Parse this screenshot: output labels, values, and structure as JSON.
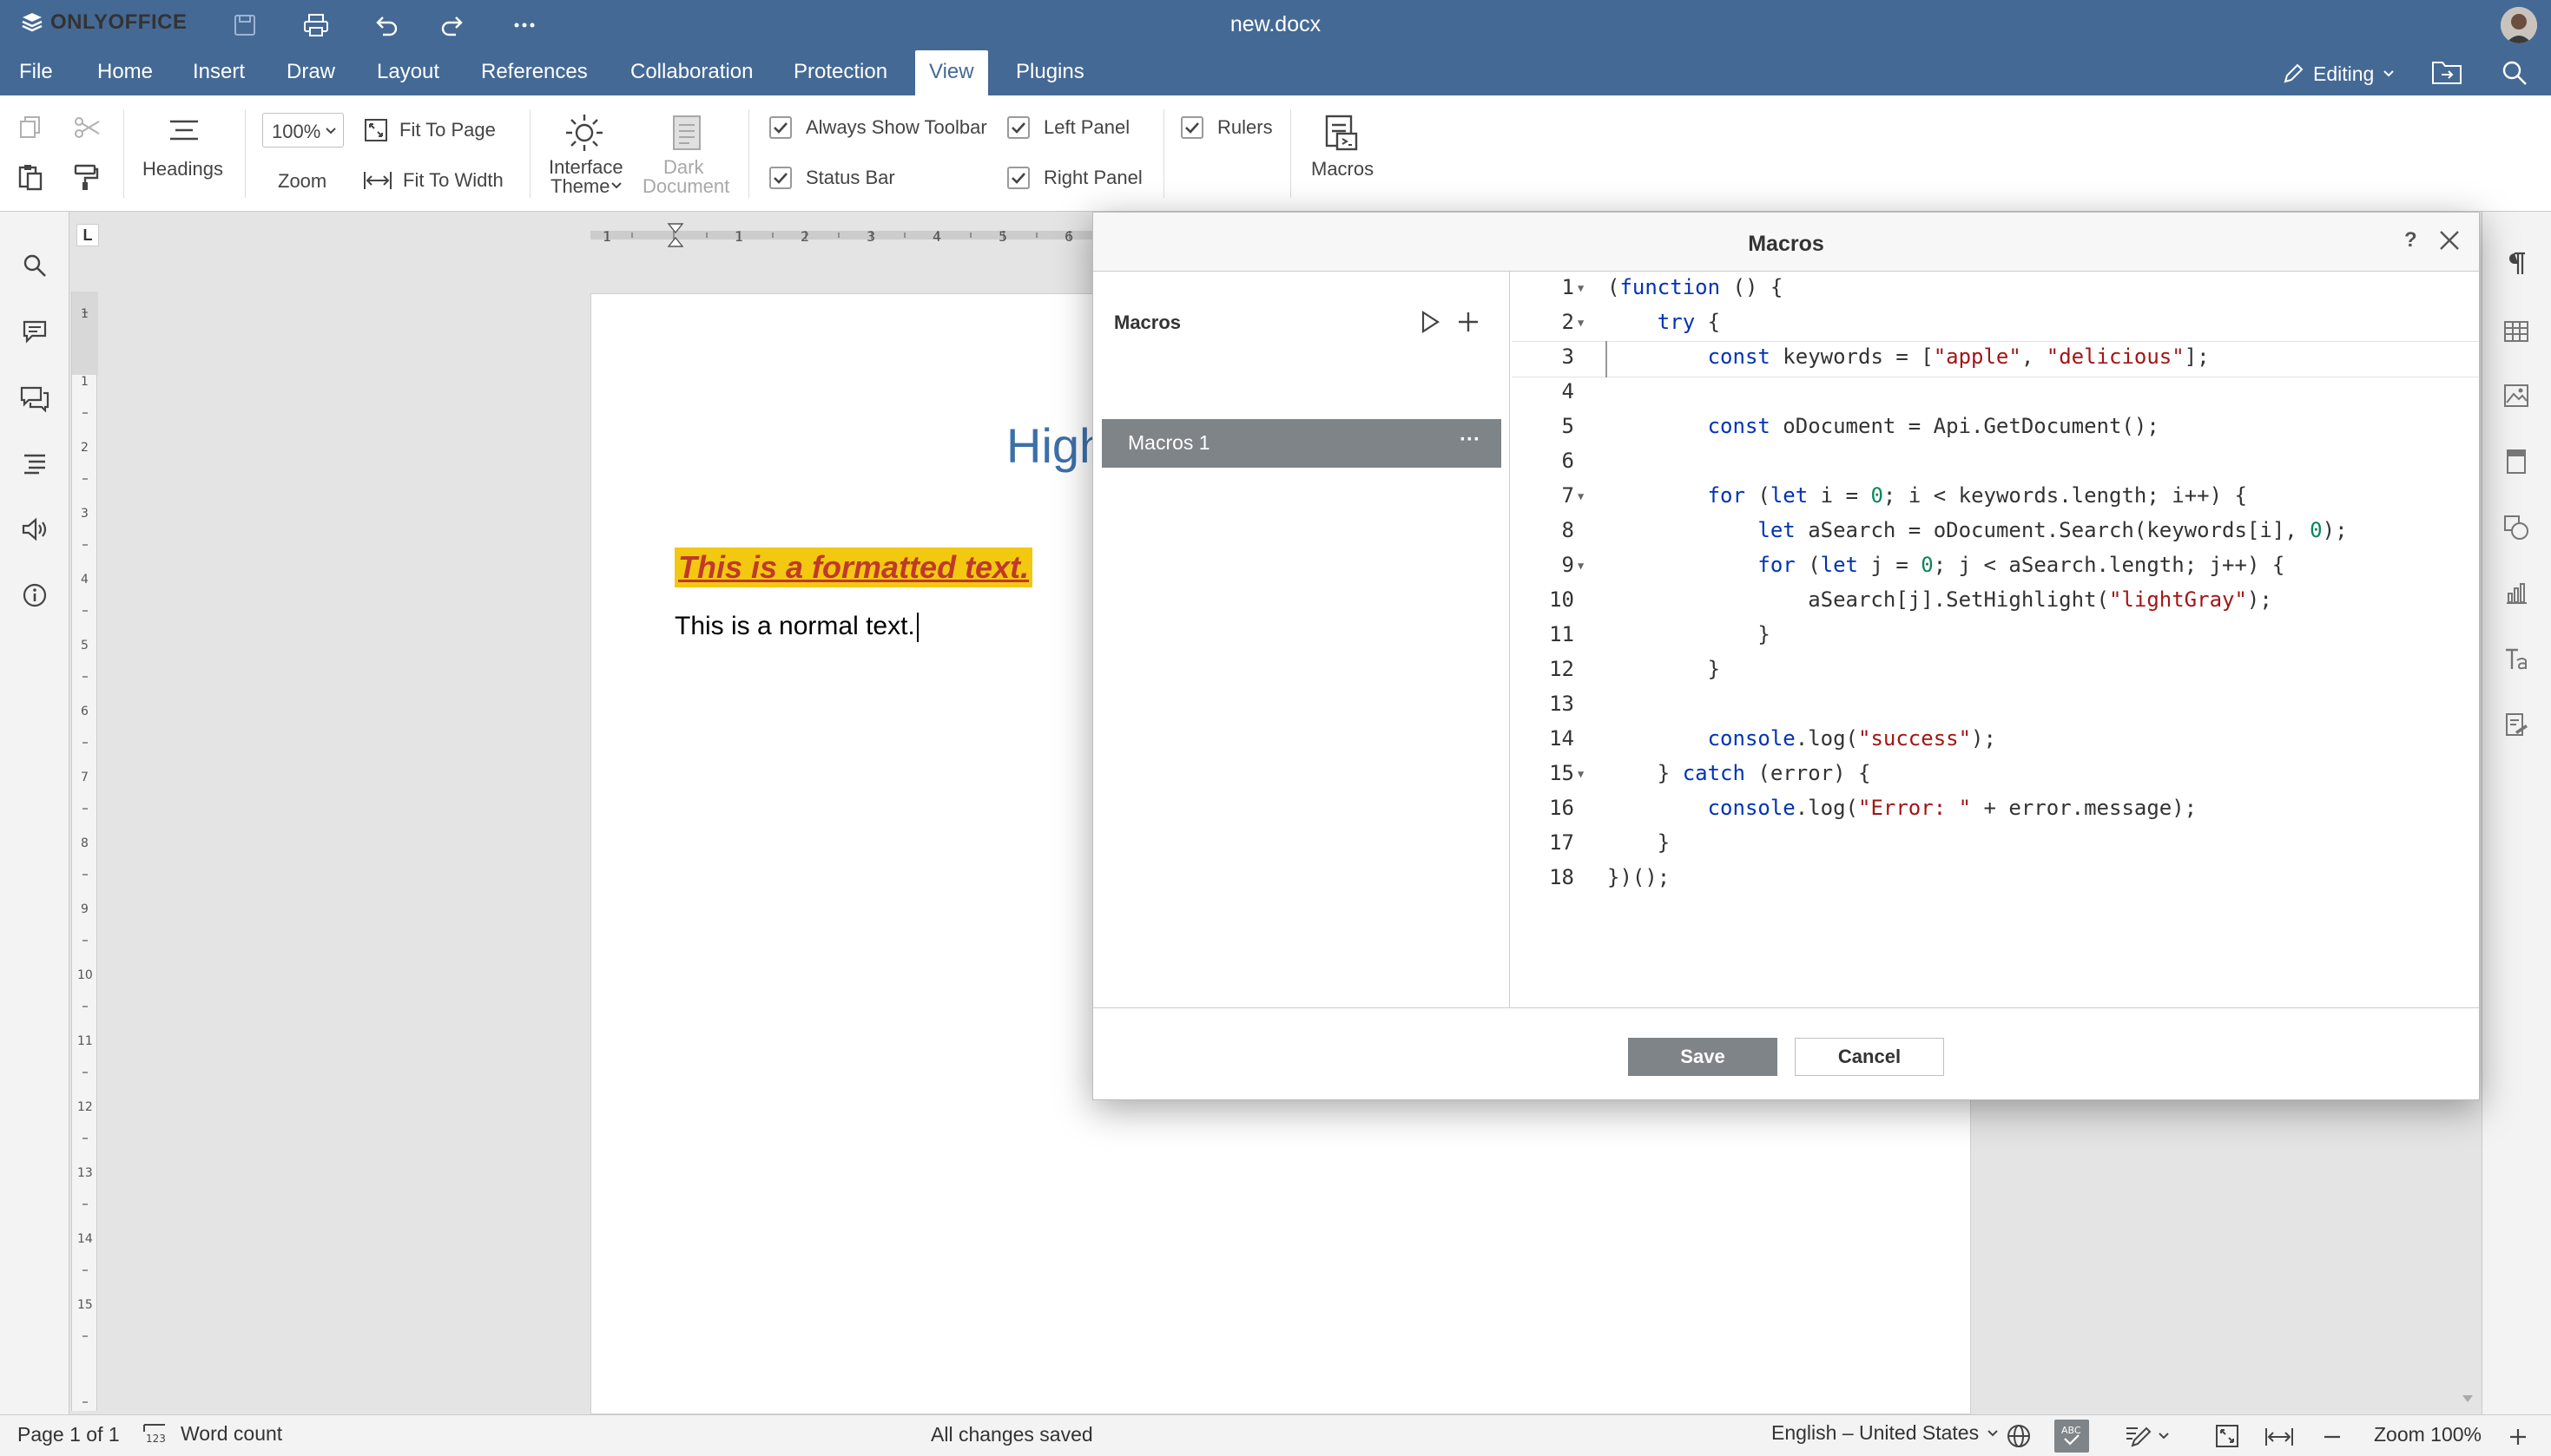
{
  "app": {
    "brand": "ONLYOFFICE",
    "doc_title": "new.docx"
  },
  "menu": [
    "File",
    "Home",
    "Insert",
    "Draw",
    "Layout",
    "References",
    "Collaboration",
    "Protection",
    "View",
    "Plugins"
  ],
  "menu_active": "View",
  "editing_label": "Editing",
  "toolbar": {
    "headings": "Headings",
    "zoom_value": "100%",
    "zoom": "Zoom",
    "fit_to_page": "Fit To Page",
    "fit_to_width": "Fit To Width",
    "interface_theme_1": "Interface",
    "interface_theme_2": "Theme",
    "dark_document_1": "Dark",
    "dark_document_2": "Document",
    "always_show_toolbar": "Always Show Toolbar",
    "status_bar": "Status Bar",
    "left_panel": "Left Panel",
    "right_panel": "Right Panel",
    "rulers": "Rulers",
    "macros": "Macros"
  },
  "ruler": {
    "corner": "L"
  },
  "document": {
    "heading": "High",
    "formatted_text": "This is a formatted text.",
    "normal_text": "This is a normal text."
  },
  "modal": {
    "title": "Macros",
    "help": "?",
    "list_title": "Macros",
    "macro_item": "Macros 1",
    "more": "···",
    "save": "Save",
    "cancel": "Cancel",
    "line_numbers": [
      "1",
      "2",
      "3",
      "4",
      "5",
      "6",
      "7",
      "8",
      "9",
      "10",
      "11",
      "12",
      "13",
      "14",
      "15",
      "16",
      "17",
      "18"
    ]
  },
  "status": {
    "page": "Page 1 of 1",
    "word_count": "Word count",
    "saved": "All changes saved",
    "language": "English – United States",
    "zoom": "Zoom 100%"
  },
  "colors": {
    "header": "#446995",
    "accent_button": "#7f8488",
    "highlight": "#f2c811",
    "formatted_text": "#c0392b"
  }
}
